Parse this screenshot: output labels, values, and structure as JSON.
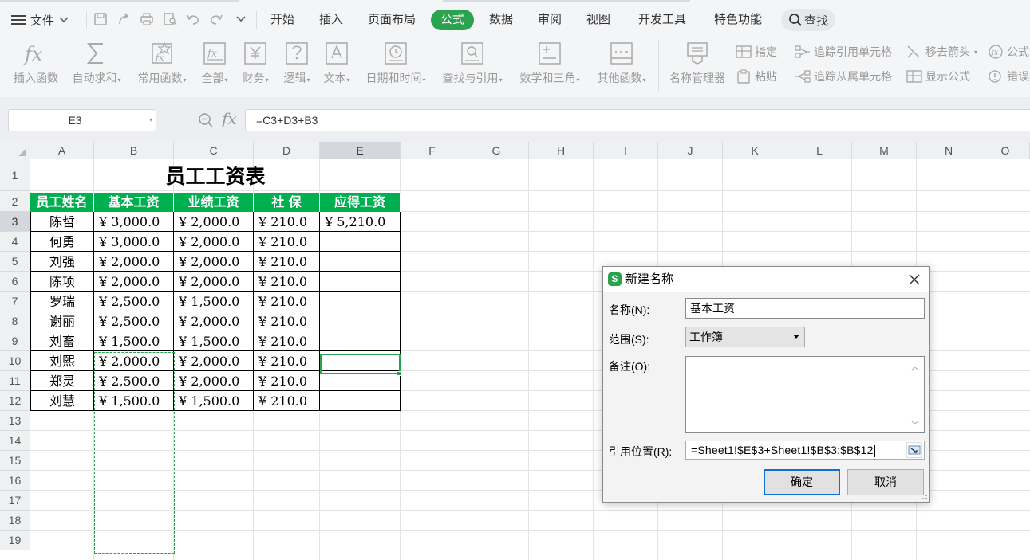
{
  "menu": {
    "file_label": "文件",
    "tabs": [
      "开始",
      "插入",
      "页面布局",
      "公式",
      "数据",
      "审阅",
      "视图",
      "开发工具",
      "特色功能"
    ],
    "active_tab": "公式",
    "search_label": "查找"
  },
  "ribbon": {
    "large_buttons": [
      {
        "label": "插入函数",
        "icon": "fx-icon",
        "caret": false
      },
      {
        "label": "自动求和",
        "icon": "sigma-icon",
        "caret": true
      },
      {
        "label": "常用函数",
        "icon": "star-function-icon",
        "caret": true
      },
      {
        "label": "全部",
        "icon": "fx-box-icon",
        "caret": true
      },
      {
        "label": "财务",
        "icon": "yen-box-icon",
        "caret": true
      },
      {
        "label": "逻辑",
        "icon": "question-box-icon",
        "caret": true
      },
      {
        "label": "文本",
        "icon": "text-a-icon",
        "caret": true
      },
      {
        "label": "日期和时间",
        "icon": "clock-box-icon",
        "caret": true
      },
      {
        "label": "查找与引用",
        "icon": "magnifier-box-icon",
        "caret": true
      },
      {
        "label": "数学和三角",
        "icon": "math-box-icon",
        "caret": true
      },
      {
        "label": "其他函数",
        "icon": "book-icon",
        "caret": true
      },
      {
        "label": "名称管理器",
        "icon": "name-manager-icon",
        "caret": false
      }
    ],
    "small_buttons": {
      "assign": "指定",
      "paste": "粘贴",
      "trace_precedents": "追踪引用单元格",
      "trace_dependents": "追踪从属单元格",
      "remove_arrows": "移去箭头",
      "show_formulas": "显示公式",
      "formula_partial": "公式",
      "error_partial": "错误"
    }
  },
  "formula_bar": {
    "name_box": "E3",
    "fx_label": "fx",
    "formula": "=C3+D3+B3"
  },
  "sheet": {
    "columns": [
      "A",
      "B",
      "C",
      "D",
      "E",
      "F",
      "G",
      "H",
      "I",
      "J",
      "K",
      "L",
      "M",
      "N",
      "O"
    ],
    "selected_column": "E",
    "rows": [
      "1",
      "2",
      "3",
      "4",
      "5",
      "6",
      "7",
      "8",
      "9",
      "10",
      "11",
      "12",
      "13",
      "14",
      "15",
      "16",
      "17",
      "18",
      "19"
    ],
    "selected_row": "3",
    "title": "员工工资表",
    "headers": [
      "员工姓名",
      "基本工资",
      "业绩工资",
      "社 保",
      "应得工资"
    ],
    "data": [
      [
        "陈哲",
        "¥ 3,000.0",
        "¥ 2,000.0",
        "¥ 210.0",
        "¥ 5,210.0"
      ],
      [
        "何勇",
        "¥ 3,000.0",
        "¥ 2,000.0",
        "¥ 210.0",
        ""
      ],
      [
        "刘强",
        "¥ 2,000.0",
        "¥ 2,000.0",
        "¥ 210.0",
        ""
      ],
      [
        "陈项",
        "¥ 2,000.0",
        "¥ 2,000.0",
        "¥ 210.0",
        ""
      ],
      [
        "罗瑞",
        "¥ 2,500.0",
        "¥ 1,500.0",
        "¥ 210.0",
        ""
      ],
      [
        "谢丽",
        "¥ 2,500.0",
        "¥ 2,000.0",
        "¥ 210.0",
        ""
      ],
      [
        "刘畜",
        "¥ 1,500.0",
        "¥ 1,500.0",
        "¥ 210.0",
        ""
      ],
      [
        "刘熙",
        "¥ 2,000.0",
        "¥ 2,000.0",
        "¥ 210.0",
        ""
      ],
      [
        "郑灵",
        "¥ 2,500.0",
        "¥ 2,000.0",
        "¥ 210.0",
        ""
      ],
      [
        "刘慧",
        "¥ 1,500.0",
        "¥ 1,500.0",
        "¥ 210.0",
        ""
      ]
    ],
    "header_color": "#00b050",
    "accent_color": "#2ba24d"
  },
  "dialog": {
    "logo": "S",
    "title": "新建名称",
    "name_label": "名称(N):",
    "name_value": "基本工资",
    "scope_label": "范围(S):",
    "scope_value": "工作簿",
    "comment_label": "备注(O):",
    "comment_value": "",
    "ref_label": "引用位置(R):",
    "ref_value": "=Sheet1!$E$3+Sheet1!$B$3:$B$12",
    "ok_label": "确定",
    "cancel_label": "取消"
  }
}
